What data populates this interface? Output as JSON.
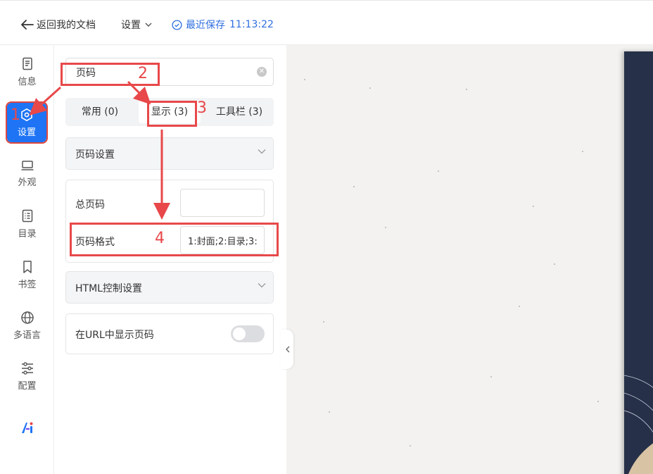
{
  "header": {
    "back_label": "返回我的文档",
    "settings_label": "设置",
    "saved_label": "最近保存",
    "saved_time": "11:13:22"
  },
  "rail": {
    "items": [
      {
        "label": "信息",
        "icon": "document-info-icon"
      },
      {
        "label": "设置",
        "icon": "settings-hexagon-icon",
        "active": true
      },
      {
        "label": "外观",
        "icon": "laptop-icon"
      },
      {
        "label": "目录",
        "icon": "list-icon"
      },
      {
        "label": "书签",
        "icon": "bookmark-icon"
      },
      {
        "label": "多语言",
        "icon": "globe-icon"
      },
      {
        "label": "配置",
        "icon": "sliders-icon"
      }
    ],
    "logo": "ai-logo"
  },
  "panel": {
    "search_value": "页码",
    "tabs": [
      {
        "label": "常用 (0)"
      },
      {
        "label": "显示 (3)",
        "active": true
      },
      {
        "label": "工具栏 (3)"
      }
    ],
    "section_page_settings": "页码设置",
    "total_pages_label": "总页码",
    "total_pages_value": "",
    "page_format_label": "页码格式",
    "page_format_value": "1:封面;2:目录;3:",
    "section_html": "HTML控制设置",
    "show_in_url_label": "在URL中显示页码",
    "show_in_url_enabled": false
  },
  "annotations": [
    "1",
    "2",
    "3",
    "4"
  ],
  "colors": {
    "accent": "#1e74f5",
    "saved_blue": "#2f6fe0",
    "annotation_red": "#e8484a",
    "book_cover": "#263048"
  }
}
